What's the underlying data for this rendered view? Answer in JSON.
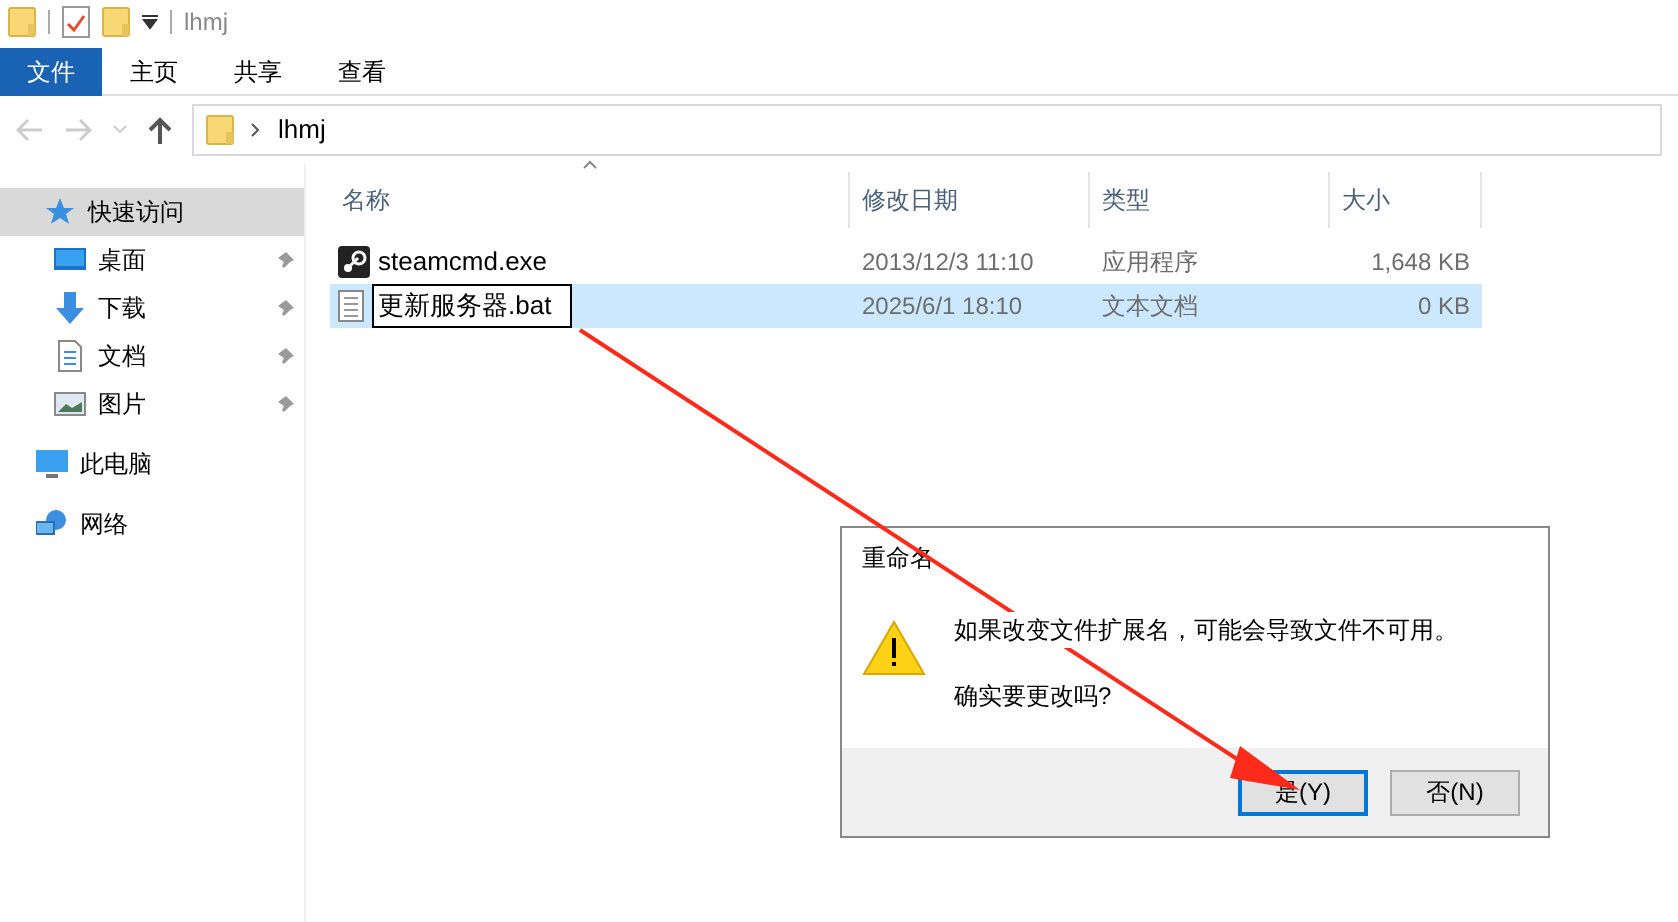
{
  "window": {
    "title": "lhmj"
  },
  "ribbon_tabs": [
    {
      "label": "文件",
      "selected": true
    },
    {
      "label": "主页",
      "selected": false
    },
    {
      "label": "共享",
      "selected": false
    },
    {
      "label": "查看",
      "selected": false
    }
  ],
  "address": {
    "path": "lhmj"
  },
  "sidebar": {
    "items": [
      {
        "label": "快速访问",
        "kind": "quick",
        "selected": true,
        "children": [
          {
            "label": "桌面",
            "kind": "desktop",
            "pinned": true
          },
          {
            "label": "下载",
            "kind": "download",
            "pinned": true
          },
          {
            "label": "文档",
            "kind": "document",
            "pinned": true
          },
          {
            "label": "图片",
            "kind": "picture",
            "pinned": true
          }
        ]
      },
      {
        "label": "此电脑",
        "kind": "pc",
        "selected": false
      },
      {
        "label": "网络",
        "kind": "network",
        "selected": false
      }
    ]
  },
  "table": {
    "columns": [
      "名称",
      "修改日期",
      "类型",
      "大小"
    ],
    "rows": [
      {
        "name": "steamcmd.exe",
        "kind": "steam",
        "date": "2013/12/3 11:10",
        "type": "应用程序",
        "size": "1,648 KB",
        "selected": false,
        "renaming": false
      },
      {
        "name": "更新服务器.bat",
        "kind": "text",
        "date": "2025/6/1 18:10",
        "type": "文本文档",
        "size": "0 KB",
        "selected": true,
        "renaming": true
      }
    ]
  },
  "dialog": {
    "title": "重命名",
    "message": "如果改变文件扩展名，可能会导致文件不可用。",
    "question": "确实要更改吗?",
    "buttons": [
      {
        "label": "是(Y)",
        "selected": true
      },
      {
        "label": "否(N)",
        "selected": false
      }
    ]
  }
}
